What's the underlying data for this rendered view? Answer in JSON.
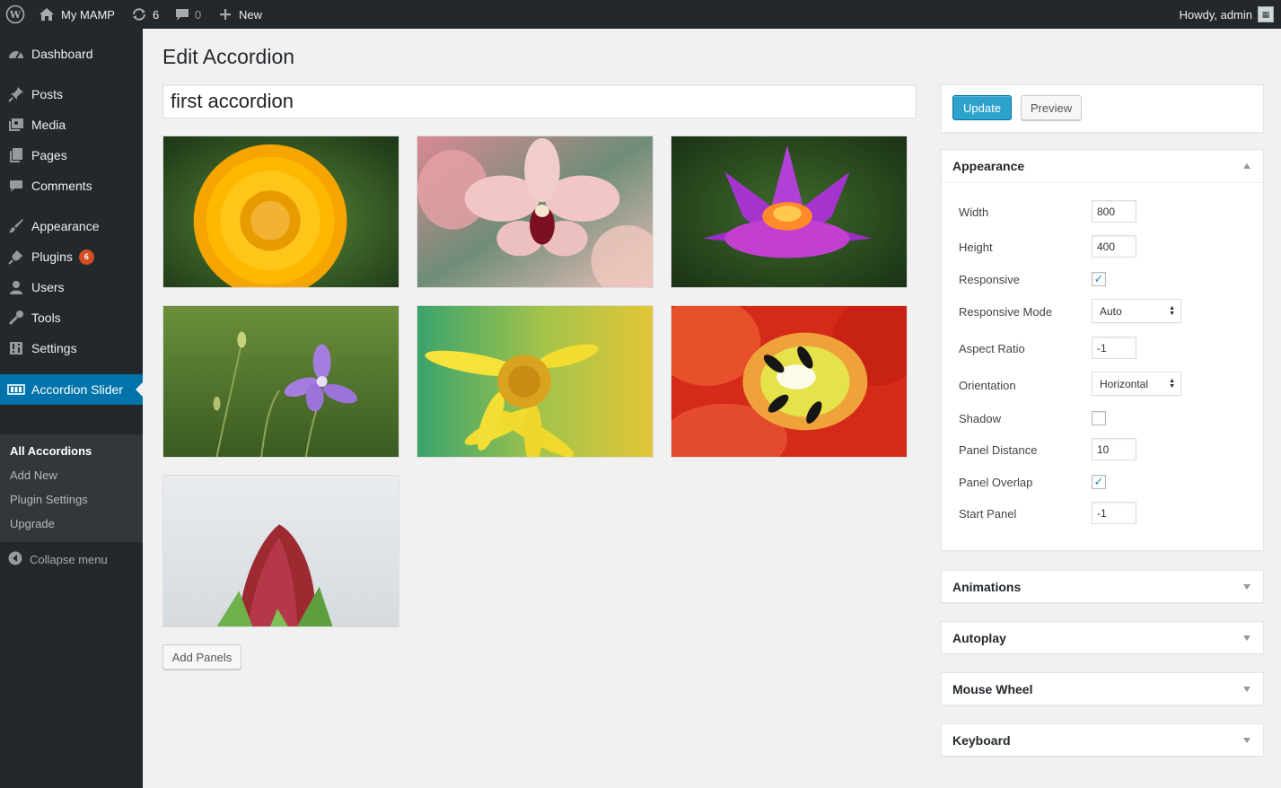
{
  "adminbar": {
    "site_name": "My MAMP",
    "updates_count": "6",
    "comments_count": "0",
    "new_label": "New",
    "howdy": "Howdy, admin"
  },
  "sidebar": {
    "items": [
      {
        "label": "Dashboard",
        "icon": "dashboard-icon"
      },
      {
        "label": "Posts",
        "icon": "pin-icon"
      },
      {
        "label": "Media",
        "icon": "media-icon"
      },
      {
        "label": "Pages",
        "icon": "pages-icon"
      },
      {
        "label": "Comments",
        "icon": "comment-icon"
      },
      {
        "label": "Appearance",
        "icon": "brush-icon"
      },
      {
        "label": "Plugins",
        "icon": "plugin-icon",
        "badge": "6"
      },
      {
        "label": "Users",
        "icon": "user-icon"
      },
      {
        "label": "Tools",
        "icon": "wrench-icon"
      },
      {
        "label": "Settings",
        "icon": "settings-icon"
      },
      {
        "label": "Accordion Slider",
        "icon": "slider-icon"
      }
    ],
    "submenu": [
      "All Accordions",
      "Add New",
      "Plugin Settings",
      "Upgrade"
    ],
    "collapse": "Collapse menu"
  },
  "main": {
    "page_title": "Edit Accordion",
    "accordion_title": "first accordion",
    "panels": [
      "yellow-flower",
      "pink-orchid",
      "purple-lotus",
      "purple-bellflower",
      "yellow-daisy",
      "red-tulip",
      "red-bud"
    ],
    "add_panels": "Add Panels"
  },
  "publish": {
    "update": "Update",
    "preview": "Preview"
  },
  "appearance": {
    "title": "Appearance",
    "fields": {
      "width": {
        "label": "Width",
        "value": "800"
      },
      "height": {
        "label": "Height",
        "value": "400"
      },
      "responsive": {
        "label": "Responsive",
        "checked": true
      },
      "responsive_mode": {
        "label": "Responsive Mode",
        "value": "Auto"
      },
      "aspect_ratio": {
        "label": "Aspect Ratio",
        "value": "-1"
      },
      "orientation": {
        "label": "Orientation",
        "value": "Horizontal"
      },
      "shadow": {
        "label": "Shadow",
        "checked": false
      },
      "panel_distance": {
        "label": "Panel Distance",
        "value": "10"
      },
      "panel_overlap": {
        "label": "Panel Overlap",
        "checked": true
      },
      "start_panel": {
        "label": "Start Panel",
        "value": "-1"
      }
    }
  },
  "collapsed_boxes": [
    "Animations",
    "Autoplay",
    "Mouse Wheel",
    "Keyboard"
  ],
  "colors": {
    "adminbar": "#23282d",
    "sidebar": "#23282d",
    "current_menu": "#0073aa",
    "primary_button": "#2ea2cc",
    "badge": "#d54e21"
  }
}
